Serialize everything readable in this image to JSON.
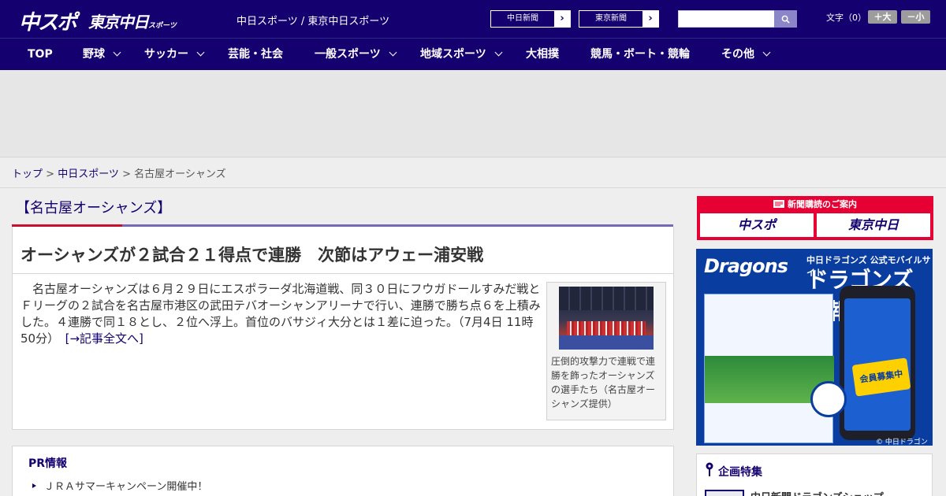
{
  "header": {
    "logo_chuspo": "中スポ",
    "logo_tokyo": "東京中日",
    "logo_tokyo_sub": "スポーツ",
    "site_name": "中日スポーツ / 東京中日スポーツ",
    "link_chunichi": "中日新聞",
    "link_tokyo": "東京新聞",
    "fontsize_label": "文字（0）",
    "font_larger": "＋大",
    "font_smaller": "－小"
  },
  "nav": [
    {
      "label": "TOP",
      "dropdown": false
    },
    {
      "label": "野球",
      "dropdown": true
    },
    {
      "label": "サッカー",
      "dropdown": true
    },
    {
      "label": "芸能・社会",
      "dropdown": false
    },
    {
      "label": "一般スポーツ",
      "dropdown": true
    },
    {
      "label": "地域スポーツ",
      "dropdown": true
    },
    {
      "label": "大相撲",
      "dropdown": false
    },
    {
      "label": "競馬・ボート・競輪",
      "dropdown": false
    },
    {
      "label": "その他",
      "dropdown": true
    }
  ],
  "breadcrumb": {
    "home": "トップ",
    "sep": " > ",
    "section": "中日スポーツ",
    "current": "名古屋オーシャンズ"
  },
  "section_title": "【名古屋オーシャンズ】",
  "article": {
    "headline": "オーシャンズが２試合２１得点で連勝　次節はアウェー浦安戦",
    "body": "名古屋オーシャンズは６月２９日にエスポラーダ北海道戦、同３０日にフウガドールすみだ戦とＦリーグの２試合を名古屋市港区の武田テバオーシャンアリーナで行い、連勝で勝ち点６を上積みした。４連勝で同１８とし、２位へ浮上。首位のバサジィ大分とは１差に迫った。",
    "timestamp": "（7月4日 11時50分）",
    "full_link": "[→記事全文へ]",
    "photo_caption": "圧倒的攻撃力で連戦で連勝を飾ったオーシャンズの選手たち（名古屋オーシャンズ提供）"
  },
  "pr": {
    "title": "PR情報",
    "items": [
      "ＪＲＡサマーキャンペーン開催中！"
    ]
  },
  "sidebar": {
    "subscribe_head": "新聞購読のご案内",
    "subscribe_chuspo": "中スポ",
    "subscribe_tokyo": "東京中日",
    "dragons_logo": "Dragons",
    "dragons_sub": "中日ドラゴンズ 公式モバイルサイト",
    "dragons_main": "ドラゴンズ情報",
    "dragons_badge": "会員募集中",
    "dragons_copy": "© 中日ドラゴンズ",
    "special_title": "企画特集",
    "special_item": "中日新聞ドラゴンズショップ"
  },
  "colors": {
    "brand": "#14006e",
    "accent_red": "#c8102e",
    "accent_purple": "#7668b5"
  }
}
